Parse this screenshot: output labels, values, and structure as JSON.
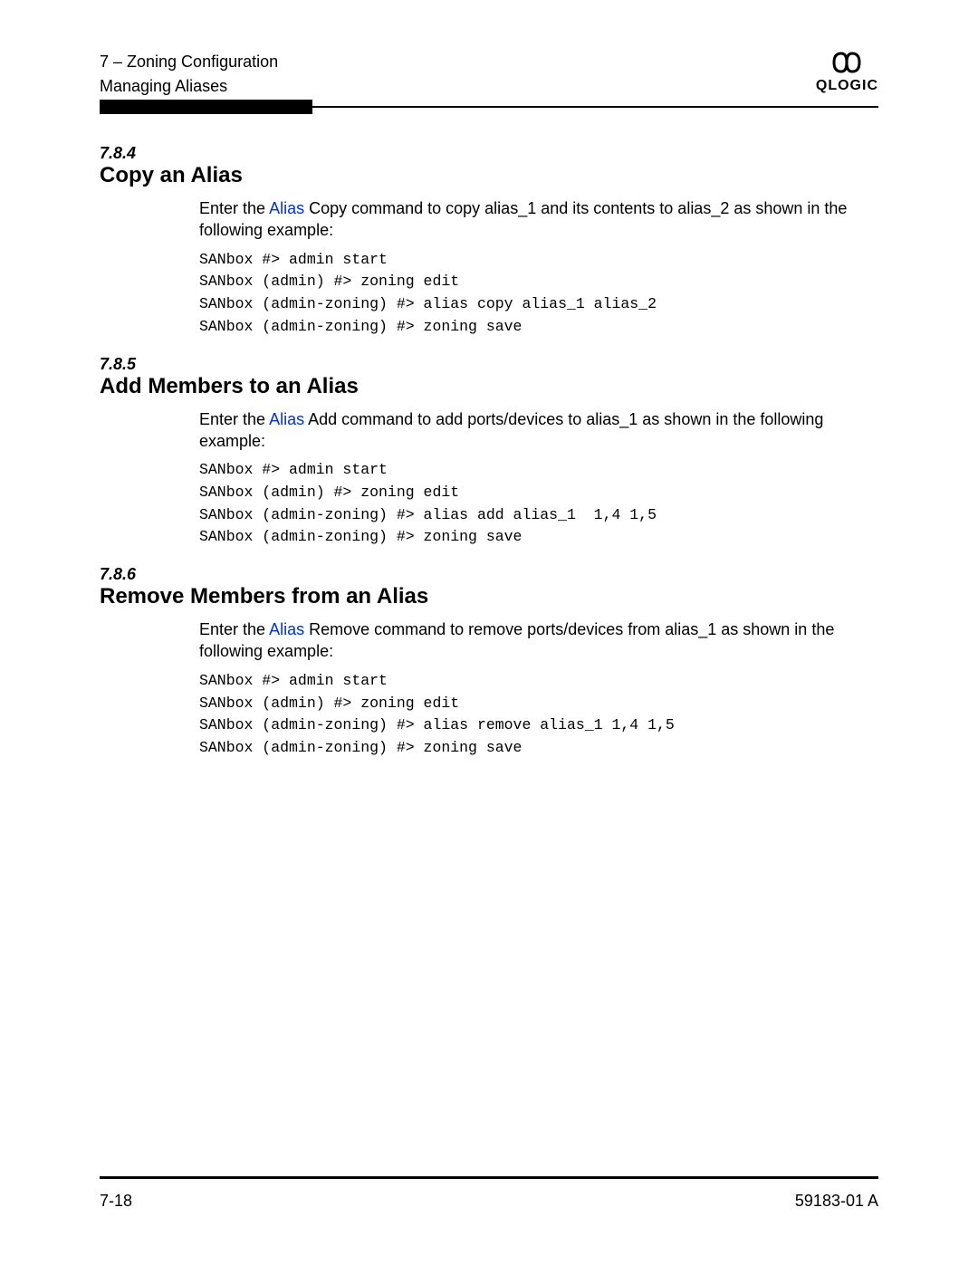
{
  "header": {
    "chapter": "7 – Zoning Configuration",
    "section": "Managing Aliases",
    "brand": "QLOGIC"
  },
  "sections": {
    "s1": {
      "num": "7.8.4",
      "title": "Copy an Alias",
      "intro_before": "Enter the ",
      "link": "Alias",
      "intro_after": " Copy command to copy alias_1 and its contents to alias_2 as shown in the following example:",
      "code": "SANbox #> admin start\nSANbox (admin) #> zoning edit\nSANbox (admin-zoning) #> alias copy alias_1 alias_2\nSANbox (admin-zoning) #> zoning save"
    },
    "s2": {
      "num": "7.8.5",
      "title": "Add Members to an Alias",
      "intro_before": "Enter the ",
      "link": "Alias",
      "intro_after": " Add command to add ports/devices to alias_1 as shown in the following example:",
      "code": "SANbox #> admin start\nSANbox (admin) #> zoning edit\nSANbox (admin-zoning) #> alias add alias_1  1,4 1,5\nSANbox (admin-zoning) #> zoning save"
    },
    "s3": {
      "num": "7.8.6",
      "title": "Remove Members from an Alias",
      "intro_before": "Enter the ",
      "link": "Alias",
      "intro_after": " Remove command to remove ports/devices from alias_1 as shown in the following example:",
      "code": "SANbox #> admin start\nSANbox (admin) #> zoning edit\nSANbox (admin-zoning) #> alias remove alias_1 1,4 1,5\nSANbox (admin-zoning) #> zoning save"
    }
  },
  "footer": {
    "page": "7-18",
    "docnum": "59183-01 A"
  }
}
